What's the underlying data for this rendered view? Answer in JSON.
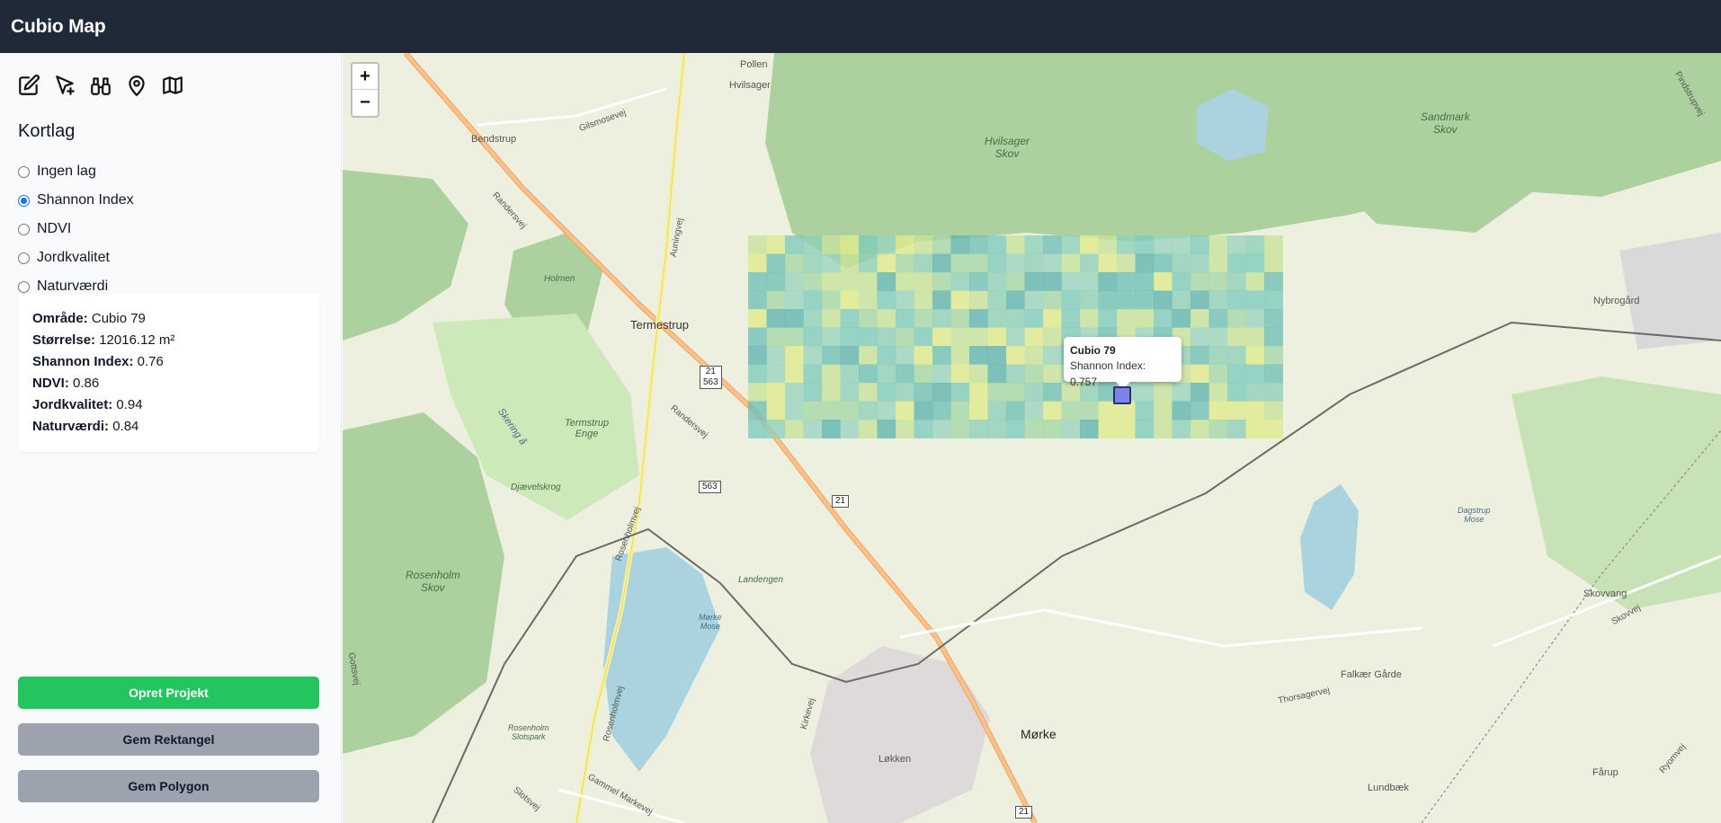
{
  "app": {
    "title": "Cubio Map"
  },
  "toolbar": {
    "tools": [
      {
        "name": "edit-icon"
      },
      {
        "name": "select-add-icon"
      },
      {
        "name": "binoculars-icon"
      },
      {
        "name": "location-pin-icon"
      },
      {
        "name": "map-icon"
      }
    ]
  },
  "layers": {
    "title": "Kortlag",
    "items": [
      {
        "label": "Ingen lag",
        "checked": false
      },
      {
        "label": "Shannon Index",
        "checked": true
      },
      {
        "label": "NDVI",
        "checked": false
      },
      {
        "label": "Jordkvalitet",
        "checked": false
      },
      {
        "label": "Naturværdi",
        "checked": false
      }
    ]
  },
  "info": {
    "area_label": "Område:",
    "area_value": "Cubio 79",
    "size_label": "Størrelse:",
    "size_value": "12016.12 m²",
    "shannon_label": "Shannon Index:",
    "shannon_value": "0.76",
    "ndvi_label": "NDVI:",
    "ndvi_value": "0.86",
    "soil_label": "Jordkvalitet:",
    "soil_value": "0.94",
    "nature_label": "Naturværdi:",
    "nature_value": "0.84"
  },
  "buttons": {
    "create_project": "Opret Projekt",
    "save_rectangle": "Gem Rektangel",
    "save_polygon": "Gem Polygon"
  },
  "map": {
    "zoom_in": "+",
    "zoom_out": "−",
    "popup": {
      "title": "Cubio 79",
      "text": "Shannon Index: 0.757"
    },
    "labels": {
      "pollen": "Pollen",
      "hvilsager": "Hvilsager",
      "bendstrup": "Bendstrup",
      "hvilsager_skov": "Hvilsager\nSkov",
      "sandmark_skov": "Sandmark\nSkov",
      "holmen": "Holmen",
      "termestrup": "Termestrup",
      "termstrup_enge": "Termstrup\nEnge",
      "djaevelskrog": "Djævelskrog",
      "nybrogard": "Nybrogård",
      "rosenholm_skov": "Rosenholm\nSkov",
      "landengen": "Landengen",
      "morke_mose": "Mørke\nMose",
      "dagstrup_mose": "Dagstrup\nMose",
      "skovvang": "Skovvang",
      "falkaer_garde": "Falkær Gårde",
      "morke": "Mørke",
      "lokken": "Løkken",
      "lundbaek": "Lundbæk",
      "farup": "Fårup",
      "rosenholm_slotspark": "Rosenholm\nSlotspark",
      "randersvej": "Randersvej",
      "thorsagervej": "Thorsagervej",
      "rosenholmvej": "Rosenholmvej",
      "gammel_markevej": "Gammel Markevej",
      "slotsvej": "Slotsvej",
      "skering_a": "Skering å",
      "gilsmosevej": "Gilsmosevej",
      "auningvej": "Auningvej",
      "kirkevej": "Kirkevej",
      "skovvej": "Skovvej",
      "ryomvej": "Ryomvej",
      "pindstrupvej": "Pindstrupvej",
      "gottsvej": "Gottsvej"
    },
    "shields": [
      "21\n563",
      "563",
      "21",
      "21"
    ]
  },
  "colors": {
    "topbar": "#1f2937",
    "green_button": "#22c55e",
    "gray_button": "#9ca3af",
    "forest": "#add19e",
    "water": "#aad3df",
    "highway": "#f9b16e"
  }
}
